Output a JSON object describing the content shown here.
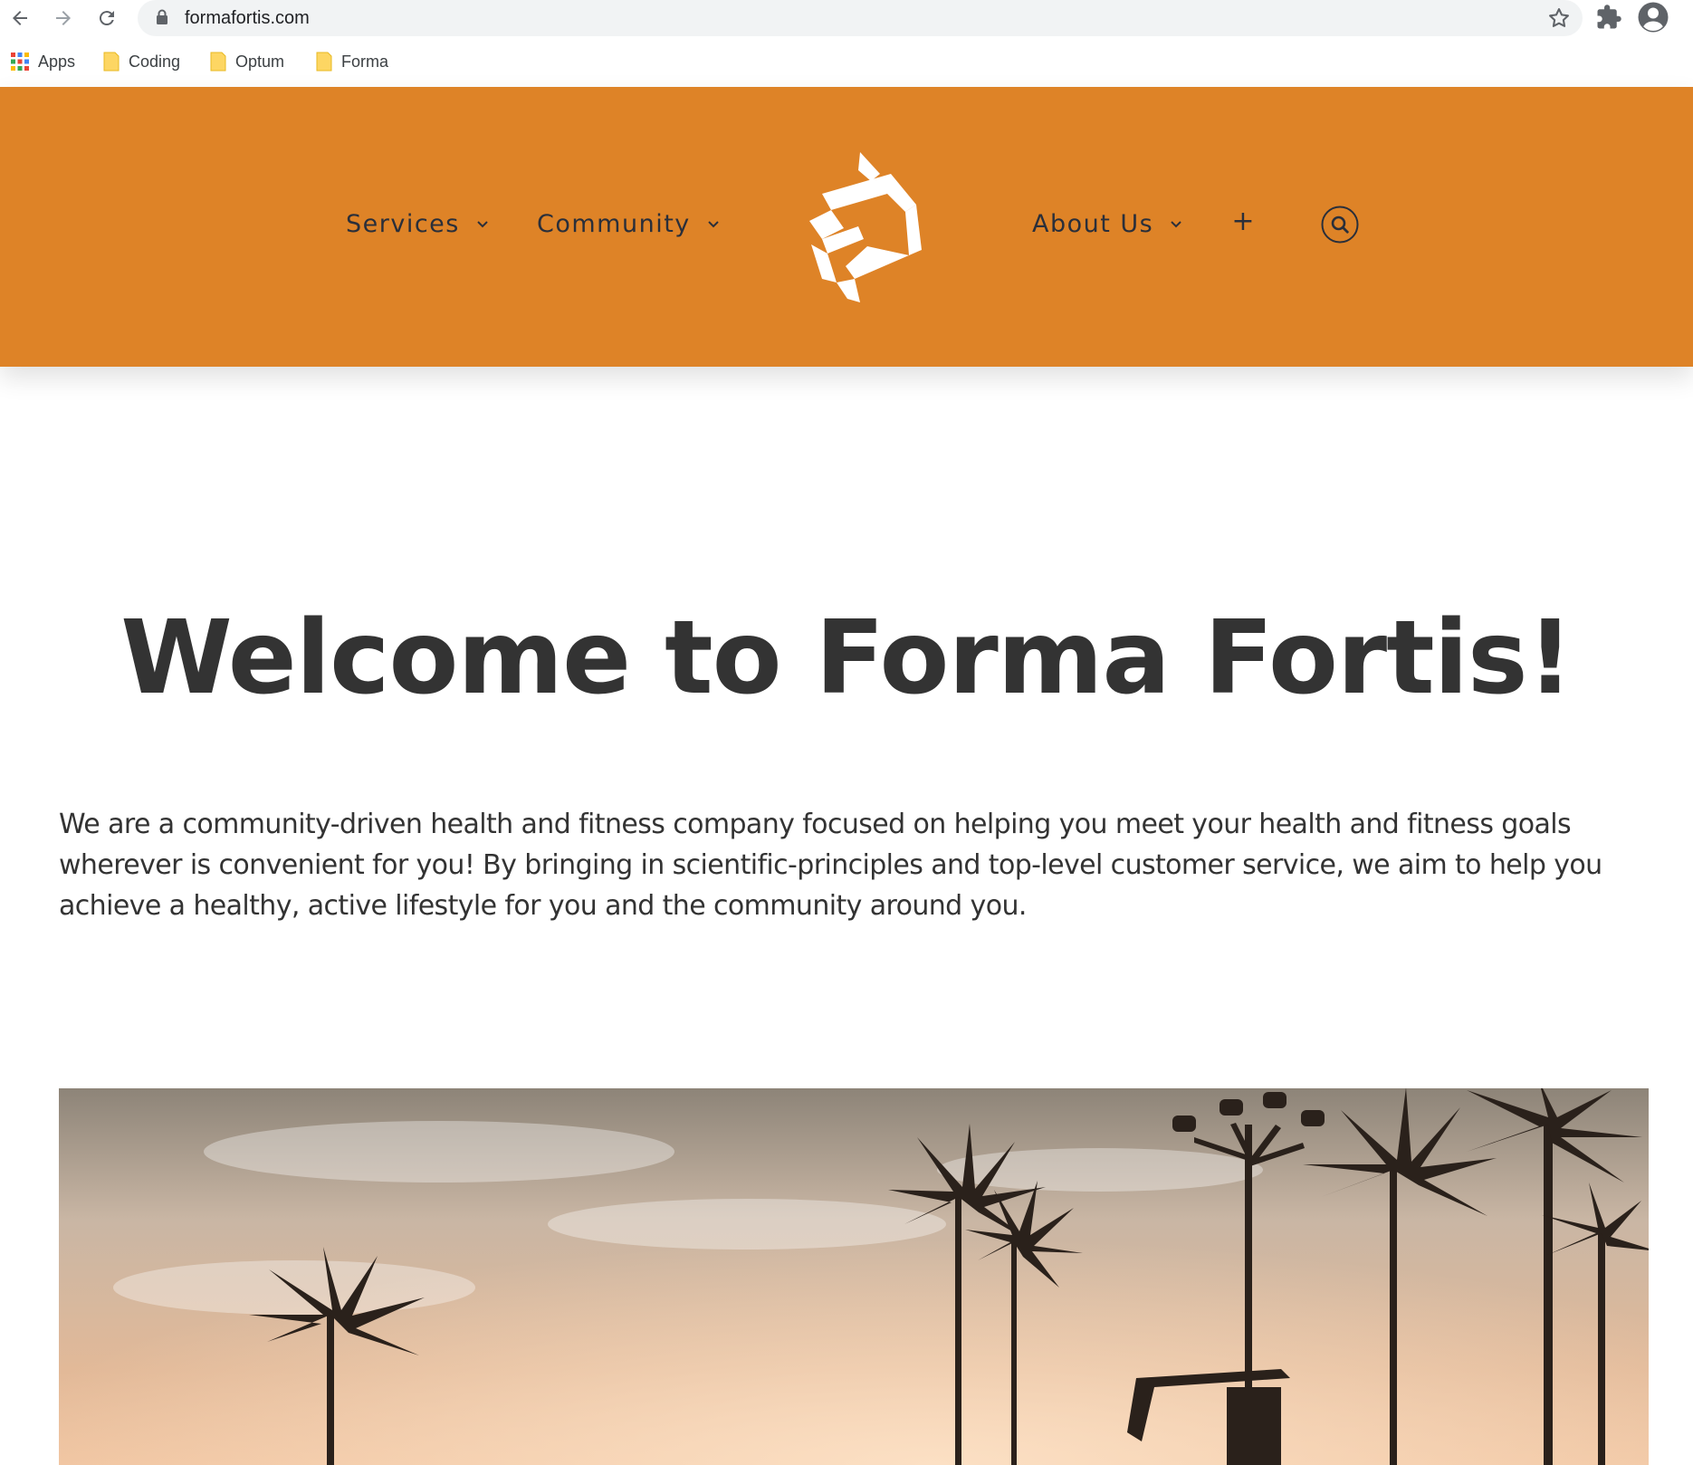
{
  "browser": {
    "url": "formafortis.com",
    "bookmarks": [
      {
        "label": "Apps",
        "icon": "apps-grid-icon"
      },
      {
        "label": "Coding",
        "icon": "folder-icon"
      },
      {
        "label": "Optum",
        "icon": "folder-icon"
      },
      {
        "label": "Forma",
        "icon": "folder-icon"
      }
    ]
  },
  "header": {
    "background_color": "#de8327",
    "nav": {
      "services": "Services",
      "community": "Community",
      "about": "About Us",
      "plus": "+"
    }
  },
  "main": {
    "headline": "Welcome to Forma Fortis!",
    "intro": "We are a community-driven health and fitness company focused on helping you meet your health and fitness goals wherever is convenient for you!  By bringing in scientific-principles and top-level customer service, we aim to help you achieve a healthy, active lifestyle for you and the community around you."
  },
  "icons": {
    "back": "back-arrow-icon",
    "forward": "forward-arrow-icon",
    "reload": "reload-icon",
    "lock": "lock-icon",
    "star": "star-icon",
    "extensions": "puzzle-icon",
    "profile": "account-icon",
    "search": "search-icon",
    "logo": "forma-fortis-logo"
  }
}
